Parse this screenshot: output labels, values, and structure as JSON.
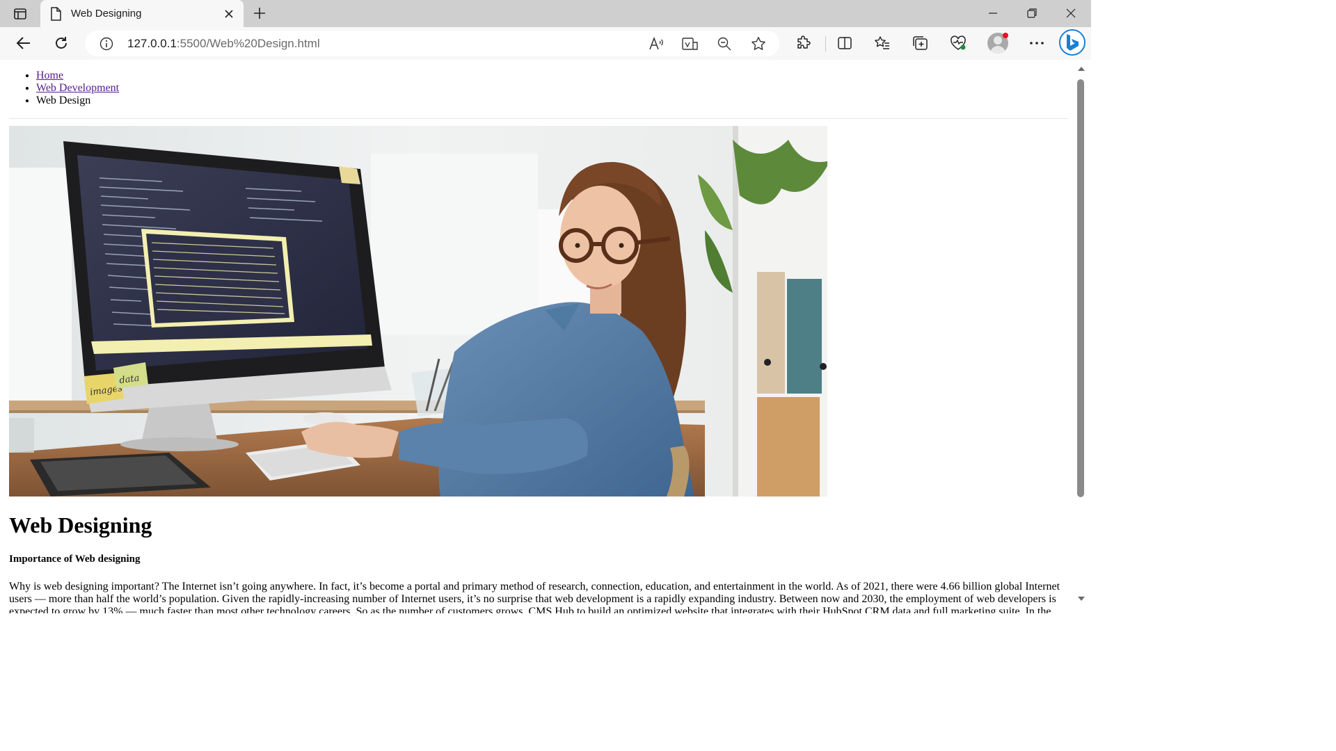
{
  "browser": {
    "tab": {
      "title": "Web Designing"
    },
    "address": {
      "host": "127.0.0.1",
      "path": ":5500/Web%20Design.html"
    }
  },
  "page": {
    "breadcrumb": [
      {
        "label": "Home",
        "is_link": true
      },
      {
        "label": "Web Development",
        "is_link": true
      },
      {
        "label": "Web Design",
        "is_link": false
      }
    ],
    "image": {
      "sticky_note_1": "images",
      "sticky_note_2": "data"
    },
    "heading": "Web Designing",
    "subheading": "Importance of Web designing",
    "paragraph": "Why is web designing important? The Internet isn’t going anywhere. In fact, it’s become a portal and primary method of research, connection, education, and entertainment in the world. As of 2021, there were 4.66 billion global Internet users — more than half the world’s population. Given the rapidly-increasing number of Internet users, it’s no surprise that web development is a rapidly expanding industry. Between now and 2030, the employment of web developers is expected to grow by 13% — much faster than most other technology careers. So as the number of customers grows, CMS Hub to build an optimized website that integrates with their HubSpot CRM data and full marketing suite. In the meantime, all"
  },
  "colors": {
    "link": "#551a8b",
    "tabstrip": "#cfcfcf",
    "toolbar": "#f7f7f7",
    "bing_accent": "#1a7fd4",
    "notification_dot": "#e81123"
  }
}
